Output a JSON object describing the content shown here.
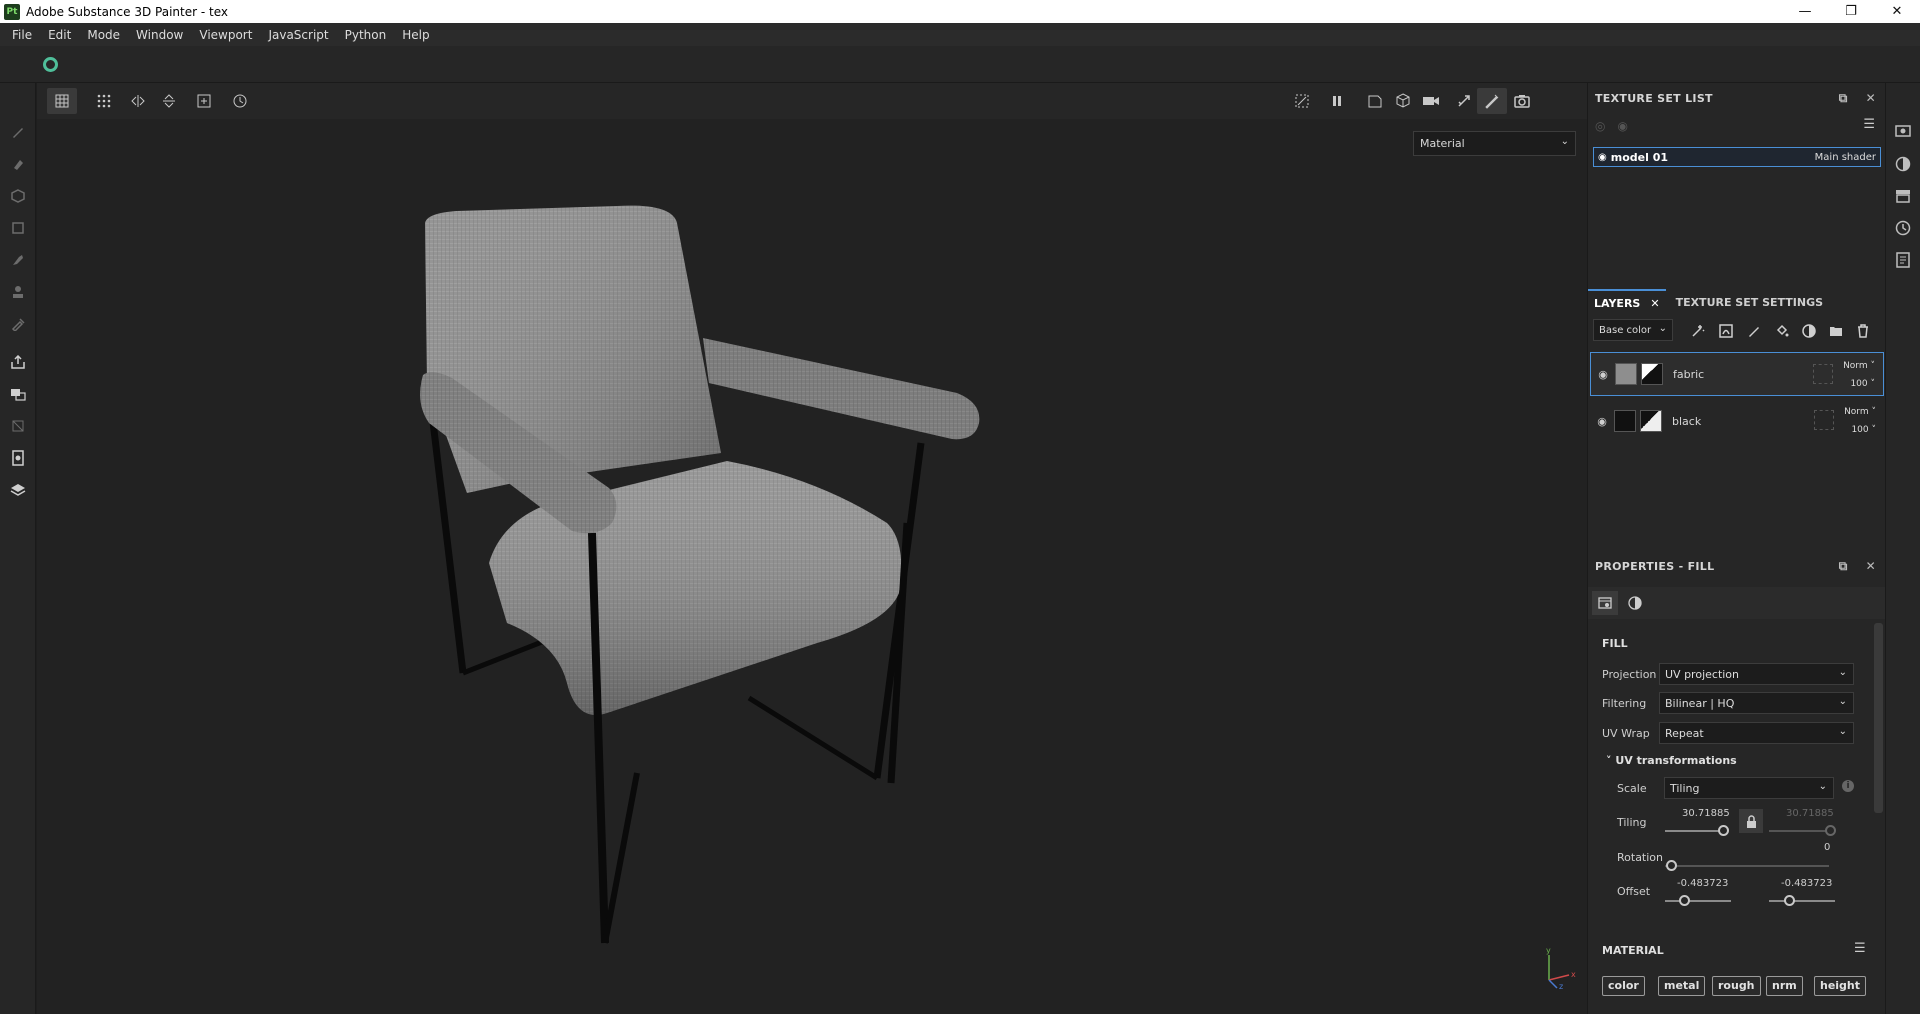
{
  "window": {
    "app_icon_label": "Pt",
    "title": "Adobe Substance 3D Painter - tex",
    "minimize": "—",
    "maximize": "❐",
    "close": "✕"
  },
  "menu": [
    "File",
    "Edit",
    "Mode",
    "Window",
    "Viewport",
    "JavaScript",
    "Python",
    "Help"
  ],
  "viewport": {
    "display_mode": "Material",
    "axis": {
      "x": "x",
      "y": "y",
      "z": "z"
    }
  },
  "texture_set_list": {
    "title": "TEXTURE SET LIST",
    "item_name": "model 01",
    "item_shader": "Main shader"
  },
  "layers_panel": {
    "tab_layers": "LAYERS",
    "tab_settings": "TEXTURE SET SETTINGS",
    "channel": "Base color",
    "layers": [
      {
        "name": "fabric",
        "blend": "Norm",
        "opacity": "100"
      },
      {
        "name": "black",
        "blend": "Norm",
        "opacity": "100"
      }
    ]
  },
  "properties": {
    "title": "PROPERTIES - FILL",
    "fill_title": "FILL",
    "projection_label": "Projection",
    "projection_value": "UV projection",
    "filtering_label": "Filtering",
    "filtering_value": "Bilinear | HQ",
    "uvwrap_label": "UV Wrap",
    "uvwrap_value": "Repeat",
    "uv_transform_title": "UV transformations",
    "scale_label": "Scale",
    "scale_value": "Tiling",
    "tiling_label": "Tiling",
    "tiling_u": "30.71885",
    "tiling_v": "30.71885",
    "rotation_label": "Rotation",
    "rotation_value": "0",
    "offset_label": "Offset",
    "offset_u": "-0.483723",
    "offset_v": "-0.483723",
    "material_title": "MATERIAL",
    "channels": [
      "color",
      "metal",
      "rough",
      "nrm",
      "height"
    ]
  }
}
